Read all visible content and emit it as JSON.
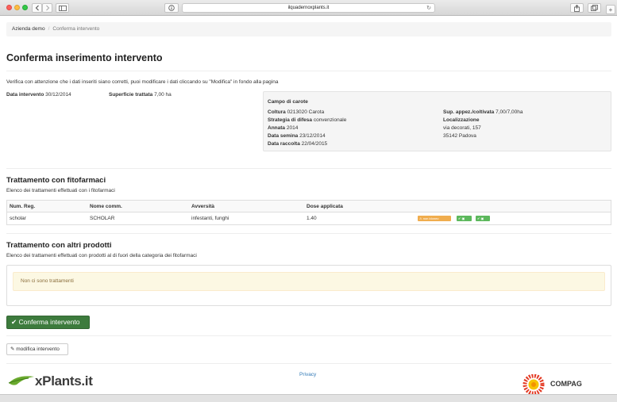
{
  "browser": {
    "url": "ilquadernoxplants.it",
    "icons": [
      "back-icon",
      "forward-icon",
      "sidebar-icon",
      "info-icon",
      "reload-icon",
      "share-icon",
      "tabs-icon"
    ]
  },
  "breadcrumb": {
    "items": [
      "Azienda demo",
      "Conferma intervento"
    ],
    "separator": "/"
  },
  "page": {
    "title": "Conferma inserimento intervento",
    "intro": "Verifica con attenzione che i dati inseriti siano corretti, puoi modificare i dati cliccando su \"Modifica\" in fondo alla pagina"
  },
  "summary": {
    "date_label": "Data intervento",
    "date_value": "30/12/2014",
    "area_label": "Superficie trattata",
    "area_value": "7,00 ha"
  },
  "field": {
    "title": "Campo di carote",
    "coltura_label": "Coltura",
    "coltura_value": "0213020 Carota",
    "strategia_label": "Strategia di difesa",
    "strategia_value": "convenzionale",
    "annata_label": "Annata",
    "annata_value": "2014",
    "semina_label": "Data semina",
    "semina_value": "23/12/2014",
    "raccolta_label": "Data raccolta",
    "raccolta_value": "22/04/2015",
    "sup_label": "Sup. appez./coltivata",
    "sup_value": "7,00/7,00ha",
    "loc_label": "Localizzazione",
    "loc_line1": "via decorati, 157",
    "loc_line2": "35142 Padova"
  },
  "fitofarmaci": {
    "title": "Trattamento con fitofarmaci",
    "subtitle": "Elenco dei trattamenti effettuati con i fitofarmaci",
    "headers": [
      "Num. Reg.",
      "Nome comm.",
      "Avversità",
      "Dose applicata"
    ],
    "rows": [
      {
        "reg": "scholar",
        "nome": "SCHOLAR",
        "avversita": "infestanti, funghi",
        "dose": "1.40",
        "badge_warn": "non idoneo",
        "badge_ok1": "",
        "badge_ok2": ""
      }
    ]
  },
  "altri": {
    "title": "Trattamento con altri prodotti",
    "subtitle": "Elenco dei trattamenti effettuati con prodotti al di fuori della categoria dei fitofarmaci",
    "empty": "Non ci sono trattamenti"
  },
  "actions": {
    "confirm": "Conferma intervento",
    "edit": "modifica intervento"
  },
  "footer": {
    "privacy": "Privacy",
    "logo_left": "xPlants.it",
    "logo_right": "COMPAG"
  },
  "colors": {
    "primary_green": "#3d7b3d",
    "warning": "#f0ad4e",
    "success": "#5cb85c",
    "alert_bg": "#fcf8e3",
    "link": "#337ab7"
  }
}
